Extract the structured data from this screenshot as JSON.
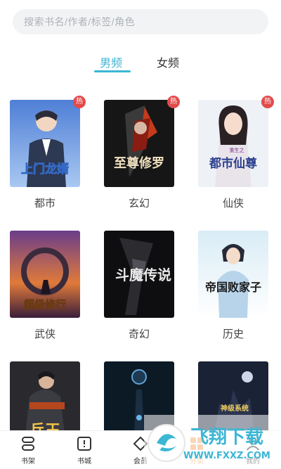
{
  "search": {
    "placeholder": "搜索书名/作者/标签/角色"
  },
  "tabs": [
    {
      "label": "男频",
      "active": true
    },
    {
      "label": "女频",
      "active": false
    }
  ],
  "hot_badge": "热",
  "books": [
    {
      "genre": "都市",
      "title": "上门龙婿",
      "hot": true
    },
    {
      "genre": "玄幻",
      "title": "至尊修罗",
      "hot": true
    },
    {
      "genre": "仙侠",
      "title": "都市仙尊",
      "hot": true,
      "subtitle": "重生之"
    },
    {
      "genre": "武侠",
      "title": "超级修行",
      "hot": false
    },
    {
      "genre": "奇幻",
      "title": "斗魔传说",
      "hot": false
    },
    {
      "genre": "历史",
      "title": "帝国败家子",
      "hot": false
    },
    {
      "genre": "",
      "title": "兵王",
      "hot": false
    },
    {
      "genre": "",
      "title": "",
      "hot": false
    },
    {
      "genre": "",
      "title": "神级系统",
      "hot": false
    }
  ],
  "tabbar": [
    {
      "label": "书架",
      "icon": "bookshelf-icon",
      "active": false
    },
    {
      "label": "书城",
      "icon": "bookstore-icon",
      "active": false
    },
    {
      "label": "会员",
      "icon": "vip-icon",
      "active": false
    },
    {
      "label": "分类",
      "icon": "category-icon",
      "active": true
    },
    {
      "label": "我的",
      "icon": "profile-icon",
      "active": false
    }
  ],
  "watermark": {
    "text": "飞翔下载",
    "url": "WWW.FXXZ.COM"
  },
  "colors": {
    "accent": "#3cb6d4",
    "hot": "#e24b4b",
    "tabbar_active": "#f5a35b"
  }
}
